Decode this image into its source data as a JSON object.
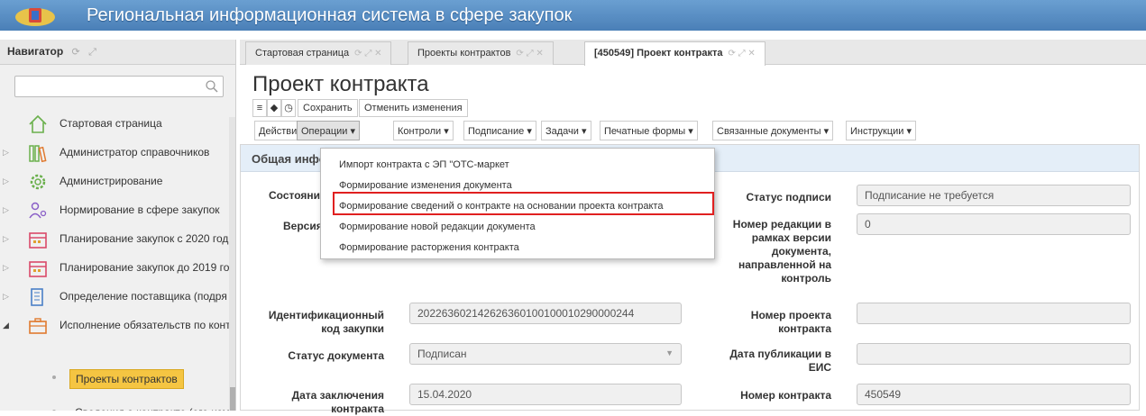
{
  "app": {
    "title": "Региональная информационная система в сфере закупок"
  },
  "navigator": {
    "title": "Навигатор",
    "search": {
      "placeholder": "",
      "value": ""
    },
    "items": [
      {
        "label": "Стартовая страница",
        "icon": "home-icon"
      },
      {
        "label": "Администратор справочников",
        "icon": "books-icon"
      },
      {
        "label": "Администрирование",
        "icon": "gear-icon"
      },
      {
        "label": "Нормирование в сфере закупок",
        "icon": "people-icon"
      },
      {
        "label": "Планирование закупок с 2020 год",
        "icon": "calendar-icon"
      },
      {
        "label": "Планирование закупок до 2019 го",
        "icon": "calendar-icon"
      },
      {
        "label": "Определение поставщика (подря",
        "icon": "building-icon"
      },
      {
        "label": "Исполнение обязательств по конт",
        "icon": "briefcase-icon"
      }
    ],
    "sub_items": [
      {
        "label": "Проекты контрактов",
        "selected": true
      },
      {
        "label": "Сведения о контракте (его изм",
        "selected": false
      }
    ]
  },
  "tabs": [
    {
      "label": "Стартовая страница",
      "active": false
    },
    {
      "label": "Проекты контрактов",
      "active": false
    },
    {
      "label": "[450549] Проект контракта",
      "active": true
    }
  ],
  "page": {
    "title": "Проект контракта"
  },
  "toolbar": {
    "save": "Сохранить",
    "cancel": "Отменить изменения"
  },
  "menus": [
    "Действия",
    "Операции",
    "Контроли",
    "Подписание",
    "Задачи",
    "Печатные формы",
    "Связанные документы",
    "Инструкции"
  ],
  "operations_menu": {
    "items": [
      "Импорт контракта с ЭП \"ОТС-маркет",
      "Формирование изменения документа",
      "Формирование сведений о контракте на основании проекта контракта",
      "Формирование новой редакции документа",
      "Формирование расторжения контракта"
    ],
    "highlighted_index": 2
  },
  "panel": {
    "title": "Общая информация",
    "fields": {
      "state_label": "Состояние",
      "version_label": "Версия",
      "sign_status_label": "Статус подписи",
      "sign_status_value": "Подписание не требуется",
      "revision_label": "Номер редакции в рамках версии документа, направленной на контроль",
      "revision_value": "0",
      "ikz_label": "Идентификационный код закупки",
      "ikz_value": "202263602142626360100100010290000244",
      "project_number_label": "Номер проекта контракта",
      "project_number_value": "",
      "doc_status_label": "Статус документа",
      "doc_status_value": "Подписан",
      "eis_date_label": "Дата публикации в ЕИС",
      "eis_date_value": "",
      "conclusion_date_label": "Дата заключения контракта",
      "conclusion_date_value": "15.04.2020",
      "contract_number_label": "Номер контракта",
      "contract_number_value": "450549"
    }
  },
  "colors": {
    "header": "#5b8fc7",
    "selected_item": "#f5c542",
    "highlight_border": "#e02020"
  }
}
